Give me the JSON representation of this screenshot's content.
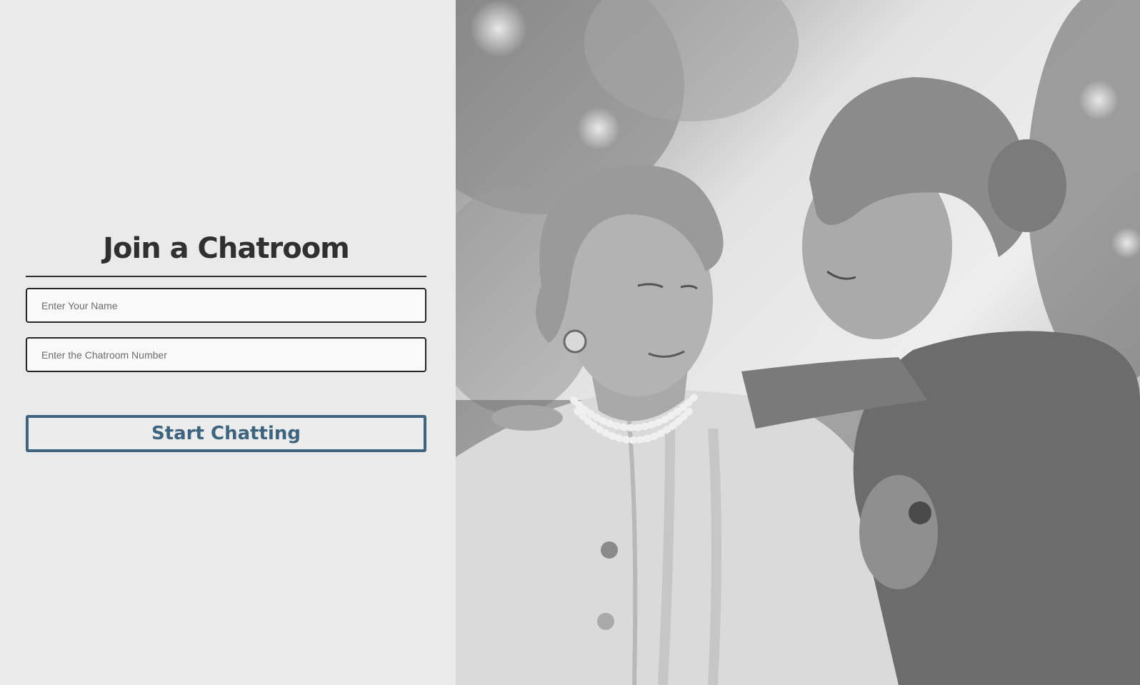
{
  "form": {
    "title": "Join a Chatroom",
    "name_placeholder": "Enter Your Name",
    "name_value": "",
    "room_placeholder": "Enter the Chatroom Number",
    "room_value": "",
    "submit_label": "Start Chatting"
  },
  "colors": {
    "background": "#eaeaea",
    "title": "#303030",
    "accent": "#3e6480"
  },
  "hero_image": {
    "description_icon": "photo-icon"
  }
}
